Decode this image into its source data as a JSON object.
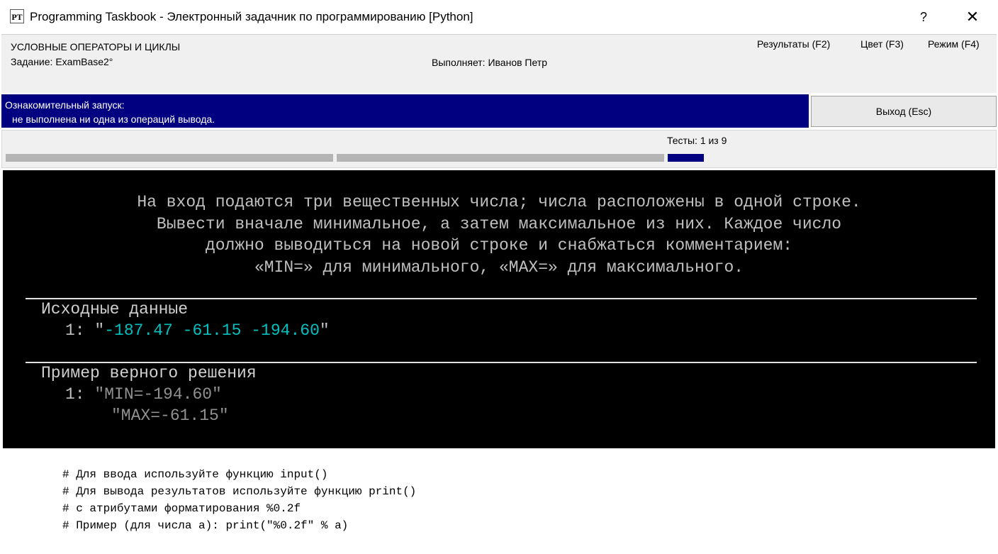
{
  "window": {
    "app_icon": "PT",
    "title": "Programming Taskbook - Электронный задачник по программированию [Python]",
    "help_glyph": "?",
    "close_glyph": "✕"
  },
  "info": {
    "group": "УСЛОВНЫЕ ОПЕРАТОРЫ И ЦИКЛЫ",
    "task": "Задание: ExamBase2°",
    "student": "Выполняет: Иванов Петр",
    "menu": {
      "results": "Результаты (F2)",
      "color": "Цвет (F3)",
      "mode": "Режим (F4)"
    }
  },
  "status": {
    "line1": "Ознакомительный запуск:",
    "line2": "не выполнена ни одна из операций вывода.",
    "exit_label": "Выход (Esc)"
  },
  "progress": {
    "tests_label": "Тесты:",
    "tests_value": "1 из 9",
    "current_test": 1,
    "total_tests": 9
  },
  "task": {
    "text_lines": [
      "На вход подаются три вещественных числа; числа расположены в одной строке.",
      "Вывести вначале минимальное, а затем максимальное из них. Каждое число",
      "должно выводиться на новой строке и снабжаться комментарием:",
      "«MIN=» для минимального, «MAX=» для максимального."
    ],
    "input_title": "Исходные данные",
    "input_prefix": "1: \"",
    "input_value": "-187.47 -61.15 -194.60",
    "input_suffix": "\"",
    "example_title": "Пример верного решения",
    "example_prefix": "1: ",
    "example_lines": [
      "\"MIN=-194.60\"",
      "\"MAX=-61.15\""
    ]
  },
  "hints": [
    "# Для ввода используйте функцию input()",
    "# Для вывода результатов используйте функцию print()",
    "# с атрибутами форматирования %0.2f",
    "# Пример (для числа a): print(\"%0.2f\" % a)"
  ],
  "colors": {
    "status_bg": "#000080",
    "task_bg": "#000000",
    "input_number": "#00c0c0",
    "current_test_bar": "#000080"
  }
}
